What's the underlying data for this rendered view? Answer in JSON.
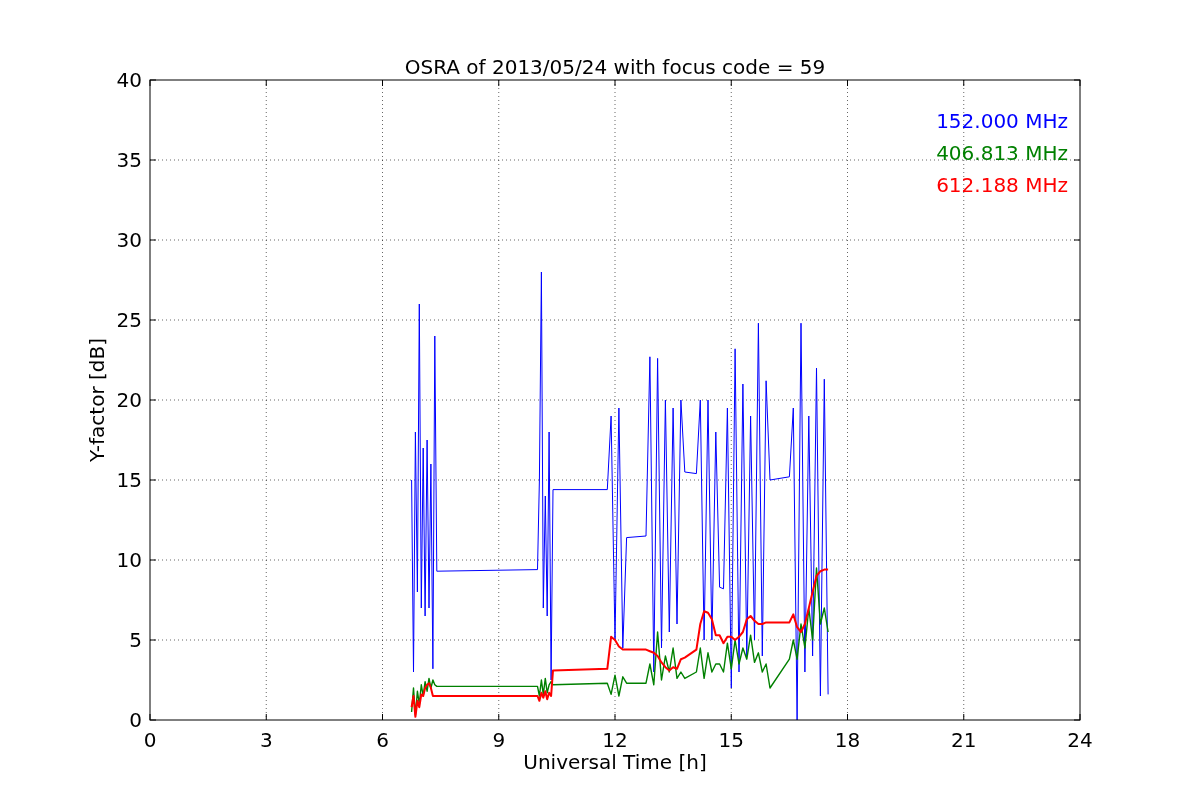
{
  "chart_data": {
    "type": "line",
    "grid": true,
    "title": "OSRA of 2013/05/24 with focus code = 59",
    "xlabel": "Universal Time [h]",
    "ylabel": "Y-factor [dB]",
    "xlim": [
      0,
      24
    ],
    "ylim": [
      0,
      40
    ],
    "xticks": [
      0,
      3,
      6,
      9,
      12,
      15,
      18,
      21,
      24
    ],
    "yticks": [
      0,
      5,
      10,
      15,
      20,
      25,
      30,
      35,
      40
    ],
    "x": [
      6.75,
      6.8,
      6.85,
      6.9,
      6.95,
      7.0,
      7.05,
      7.1,
      7.15,
      7.2,
      7.25,
      7.3,
      7.35,
      7.4,
      10.0,
      10.05,
      10.1,
      10.15,
      10.2,
      10.25,
      10.3,
      10.35,
      10.4,
      11.8,
      11.9,
      12.0,
      12.1,
      12.2,
      12.3,
      12.8,
      12.9,
      13.0,
      13.1,
      13.2,
      13.3,
      13.4,
      13.5,
      13.6,
      13.7,
      13.8,
      14.1,
      14.2,
      14.3,
      14.4,
      14.5,
      14.6,
      14.7,
      14.8,
      14.9,
      15.0,
      15.1,
      15.2,
      15.3,
      15.4,
      15.5,
      15.6,
      15.7,
      15.8,
      15.9,
      16.0,
      16.5,
      16.6,
      16.7,
      16.8,
      16.9,
      17.0,
      17.1,
      17.2,
      17.3,
      17.4,
      17.5
    ],
    "series": [
      {
        "name": "152.000 MHz",
        "color": "#0000ff",
        "values": [
          15,
          3,
          18,
          8,
          26,
          7,
          17,
          6.5,
          17.5,
          7,
          16,
          3.2,
          24,
          9.3,
          9.4,
          15,
          28,
          7,
          14,
          6.5,
          18,
          2.5,
          14.4,
          14.4,
          19,
          5,
          19.5,
          4.5,
          11.4,
          11.5,
          22.7,
          3,
          22.6,
          4.5,
          20,
          5.5,
          19.5,
          6,
          20,
          15.5,
          15.4,
          20,
          5,
          20,
          5,
          18,
          8.3,
          8.2,
          19.5,
          2,
          23.2,
          3,
          21,
          4,
          19,
          5,
          24.8,
          4,
          21.2,
          15,
          15.2,
          19.5,
          0,
          24.8,
          3,
          19,
          4,
          22,
          1.5,
          21.3,
          1.6
        ]
      },
      {
        "name": "406.813 MHz",
        "color": "#008000",
        "values": [
          0.5,
          2,
          0.3,
          1.8,
          1,
          2.2,
          1.5,
          2.4,
          1.8,
          2.6,
          2,
          2.5,
          2.2,
          2.1,
          2.1,
          1.5,
          2.5,
          1.6,
          2.6,
          1.7,
          2.2,
          2.4,
          2.2,
          2.3,
          1.6,
          2.8,
          1.5,
          2.7,
          2.3,
          2.3,
          3.5,
          2.2,
          5.5,
          2.5,
          4,
          3,
          4.5,
          2.6,
          3,
          2.6,
          3,
          4.5,
          2.6,
          4.2,
          3,
          3.5,
          3.5,
          3,
          4.8,
          3.2,
          5,
          3.5,
          4.5,
          3.8,
          5.3,
          3.6,
          4.2,
          3,
          3.5,
          2,
          3.8,
          5,
          3.8,
          6,
          4.5,
          7,
          5,
          9.5,
          6,
          7,
          5.5
        ]
      },
      {
        "name": "612.188 MHz",
        "color": "#ff0000",
        "values": [
          0.8,
          1.5,
          0.2,
          1.2,
          0.8,
          1.6,
          1.5,
          2,
          2.2,
          2.3,
          2,
          1.5,
          1.5,
          1.5,
          1.5,
          1.2,
          1.7,
          1.4,
          1.8,
          1.3,
          1.7,
          1.5,
          3.1,
          3.2,
          5.2,
          5,
          4.6,
          4.4,
          4.4,
          4.4,
          4.3,
          4.2,
          4,
          3.6,
          3.3,
          3.1,
          3.3,
          3.2,
          3.8,
          3.9,
          4.4,
          6,
          6.8,
          6.7,
          6.3,
          5.3,
          5.3,
          4.8,
          5.2,
          5.2,
          5,
          5.2,
          5.5,
          6.3,
          6.5,
          6.2,
          6,
          6,
          6.1,
          6.1,
          6.1,
          6.6,
          5.8,
          5.5,
          6,
          7,
          8,
          9,
          9.3,
          9.4,
          9.4
        ]
      }
    ]
  }
}
